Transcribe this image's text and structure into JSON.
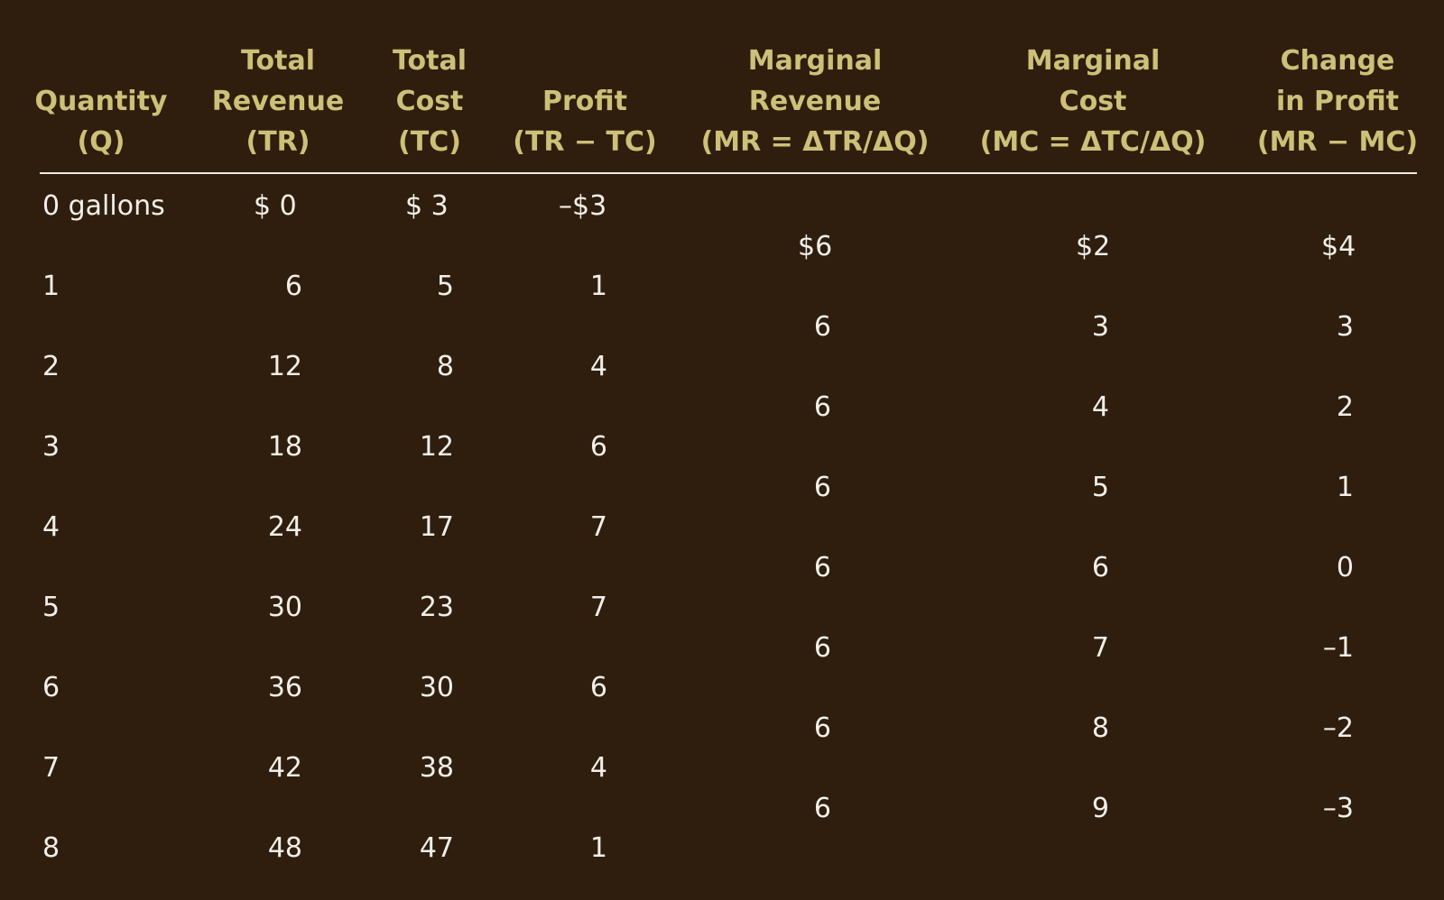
{
  "headers": [
    {
      "lines": [
        "",
        "Quantity",
        "(Q)"
      ]
    },
    {
      "lines": [
        "Total",
        "Revenue",
        "(TR)"
      ]
    },
    {
      "lines": [
        "Total",
        "Cost",
        "(TC)"
      ]
    },
    {
      "lines": [
        "",
        "Profit",
        "(TR − TC)"
      ]
    },
    {
      "lines": [
        "Marginal",
        "Revenue",
        "(MR = ΔTR/ΔQ)"
      ]
    },
    {
      "lines": [
        "Marginal",
        "Cost",
        "(MC = ΔTC/ΔQ)"
      ]
    },
    {
      "lines": [
        "Change",
        "in Profit",
        "(MR − MC)"
      ]
    }
  ],
  "rows": [
    {
      "q": "0 gallons",
      "tr": "$  0",
      "tc": "$  3",
      "profit": "–$3"
    },
    {
      "q": "1",
      "tr": "6",
      "tc": "5",
      "profit": "1"
    },
    {
      "q": "2",
      "tr": "12",
      "tc": "8",
      "profit": "4"
    },
    {
      "q": "3",
      "tr": "18",
      "tc": "12",
      "profit": "6"
    },
    {
      "q": "4",
      "tr": "24",
      "tc": "17",
      "profit": "7"
    },
    {
      "q": "5",
      "tr": "30",
      "tc": "23",
      "profit": "7"
    },
    {
      "q": "6",
      "tr": "36",
      "tc": "30",
      "profit": "6"
    },
    {
      "q": "7",
      "tr": "42",
      "tc": "38",
      "profit": "4"
    },
    {
      "q": "8",
      "tr": "48",
      "tc": "47",
      "profit": "1"
    }
  ],
  "marginals": [
    {
      "mr": "$6",
      "mc": "$2",
      "dp": "$4"
    },
    {
      "mr": "6",
      "mc": "3",
      "dp": "3"
    },
    {
      "mr": "6",
      "mc": "4",
      "dp": "2"
    },
    {
      "mr": "6",
      "mc": "5",
      "dp": "1"
    },
    {
      "mr": "6",
      "mc": "6",
      "dp": "0"
    },
    {
      "mr": "6",
      "mc": "7",
      "dp": "–1"
    },
    {
      "mr": "6",
      "mc": "8",
      "dp": "–2"
    },
    {
      "mr": "6",
      "mc": "9",
      "dp": "–3"
    }
  ]
}
